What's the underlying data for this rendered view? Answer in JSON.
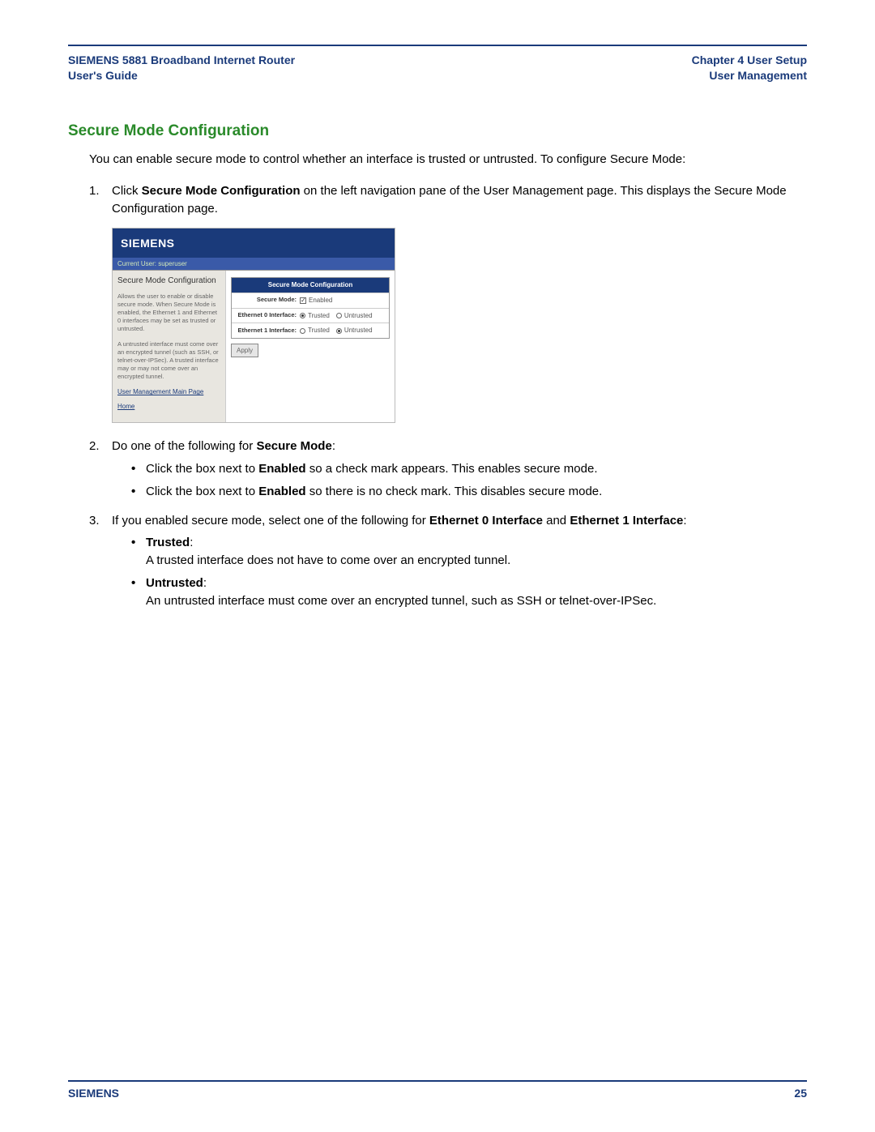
{
  "header": {
    "left_line1": "SIEMENS 5881 Broadband Internet Router",
    "left_line2": "User's Guide",
    "right_line1": "Chapter 4  User Setup",
    "right_line2": "User Management"
  },
  "section_title": "Secure Mode Configuration",
  "intro": "You can enable secure mode to control whether an interface is trusted or untrusted. To configure Secure Mode:",
  "step1": {
    "num": "1.",
    "pre": "Click ",
    "bold": "Secure Mode Configuration",
    "post": " on the left navigation pane of the User Management page. This displays the Secure Mode Configuration page."
  },
  "embed": {
    "brand": "SIEMENS",
    "bar": "Current User: superuser",
    "side_title": "Secure Mode Configuration",
    "side_p1": "Allows the user to enable or disable secure mode. When Secure Mode is enabled, the Ethernet 1 and Ethernet 0 interfaces may be set as trusted or untrusted.",
    "side_p2": "A untrusted interface must come over an encrypted tunnel (such as SSH, or telnet-over-IPSec). A trusted interface may or may not come over an encrypted tunnel.",
    "side_link1": "User Management Main Page",
    "side_link2": "Home",
    "cfg_title": "Secure Mode Configuration",
    "row_secure_label": "Secure Mode:",
    "row_secure_opt": "Enabled",
    "row_eth0_label": "Ethernet 0 Interface:",
    "row_eth1_label": "Ethernet 1 Interface:",
    "opt_trusted": "Trusted",
    "opt_untrusted": "Untrusted",
    "apply": "Apply"
  },
  "step2": {
    "num": "2.",
    "pre": "Do one of the following for ",
    "bold": "Secure Mode",
    "post": ":",
    "b1_pre": "Click the box next to ",
    "b1_bold": "Enabled",
    "b1_post": " so a check mark appears. This enables secure mode.",
    "b2_pre": "Click the box next to ",
    "b2_bold": "Enabled",
    "b2_post": " so there is no check mark. This disables secure mode."
  },
  "step3": {
    "num": "3.",
    "pre": "If you enabled secure mode, select one of the following for ",
    "bold1": "Ethernet 0 Interface",
    "mid": " and ",
    "bold2": "Ethernet 1 Interface",
    "post": ":",
    "trusted_label": "Trusted",
    "trusted_text": "A trusted interface does not have to come over an encrypted tunnel.",
    "untrusted_label": "Untrusted",
    "untrusted_text": "An untrusted interface must come over an encrypted tunnel, such as SSH or telnet-over-IPSec."
  },
  "footer": {
    "brand": "SIEMENS",
    "page": "25"
  }
}
